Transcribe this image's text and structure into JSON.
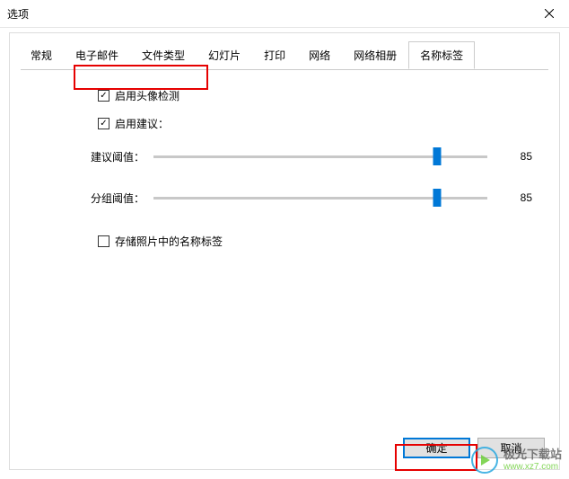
{
  "window": {
    "title": "选项"
  },
  "tabs": [
    {
      "label": "常规"
    },
    {
      "label": "电子邮件"
    },
    {
      "label": "文件类型"
    },
    {
      "label": "幻灯片"
    },
    {
      "label": "打印"
    },
    {
      "label": "网络"
    },
    {
      "label": "网络相册"
    },
    {
      "label": "名称标签"
    }
  ],
  "active_tab_index": 7,
  "options": {
    "enable_face_detection": {
      "label": "启用头像检测",
      "checked": true
    },
    "enable_suggestions": {
      "label": "启用建议：",
      "checked": true
    },
    "suggestion_threshold": {
      "label": "建议阈值：",
      "value": 85
    },
    "group_threshold": {
      "label": "分组阈值：",
      "value": 85
    },
    "store_name_tags": {
      "label": "存储照片中的名称标签",
      "checked": false
    }
  },
  "buttons": {
    "ok": "确定",
    "cancel": "取消"
  },
  "watermark": {
    "cn": "极光下载站",
    "en": "www.xz7.com"
  }
}
